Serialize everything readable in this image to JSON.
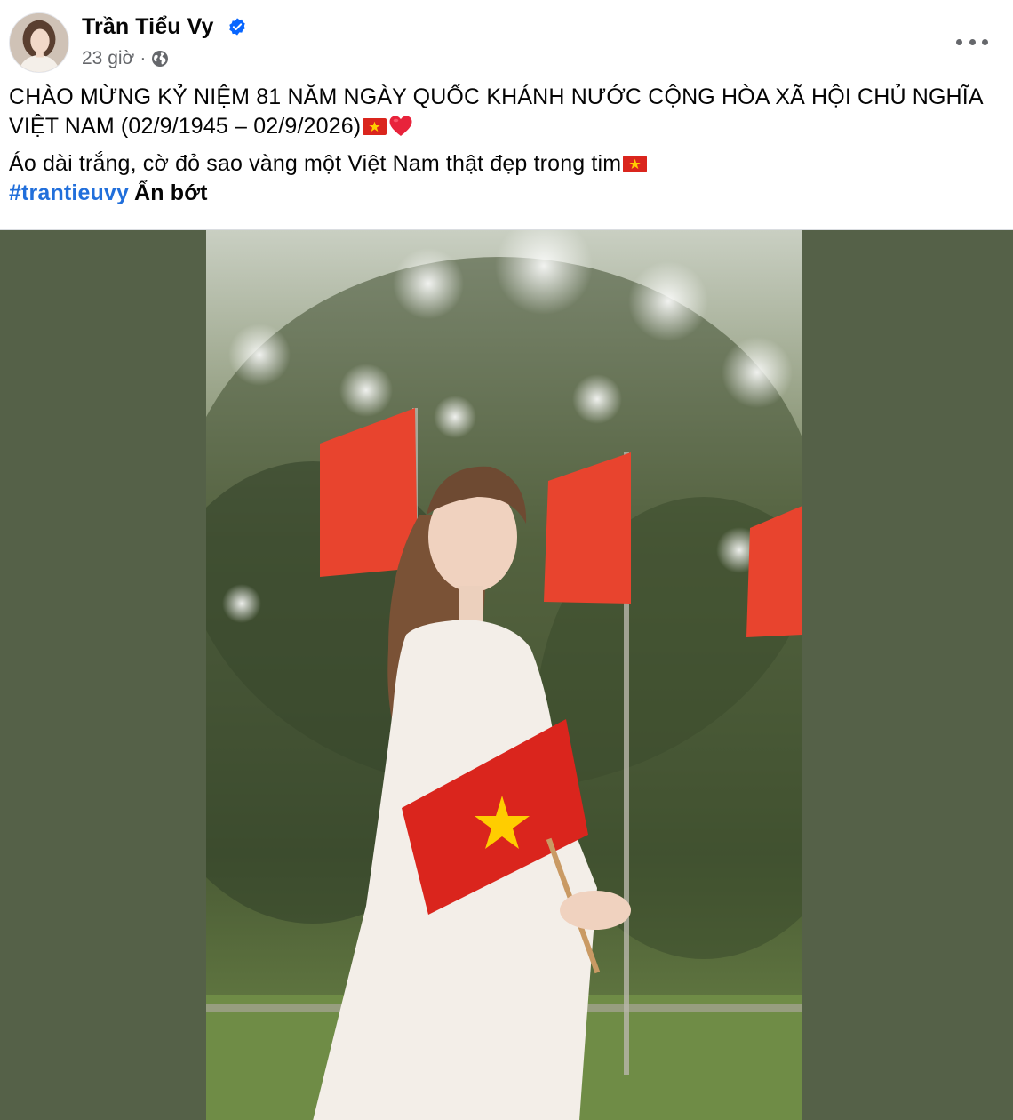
{
  "post": {
    "author": {
      "name": "Trần Tiểu Vy",
      "verified": true,
      "avatar_icon": "profile-photo"
    },
    "timestamp": "23 giờ",
    "separator": "·",
    "privacy_icon": "globe-icon",
    "menu_icon": "more-horizontal-icon",
    "text": {
      "line1": "CHÀO MỪNG KỶ NIỆM 81 NĂM NGÀY QUỐC KHÁNH NƯỚC CỘNG HÒA XÃ HỘI CHỦ NGHĨA VIỆT NAM (02/9/1945 – 02/9/2026)",
      "line2": "Áo dài trắng, cờ đỏ sao vàng một Việt Nam thật đẹp trong tim",
      "hashtag": "#trantieuvy",
      "see_less": "Ẩn bớt"
    },
    "colors": {
      "hashtag": "#216fdb",
      "secondary_text": "#65676b",
      "verified_badge": "#0866ff",
      "media_background": "#556148",
      "flag_red": "#da251d",
      "flag_star": "#ffcd00"
    }
  }
}
